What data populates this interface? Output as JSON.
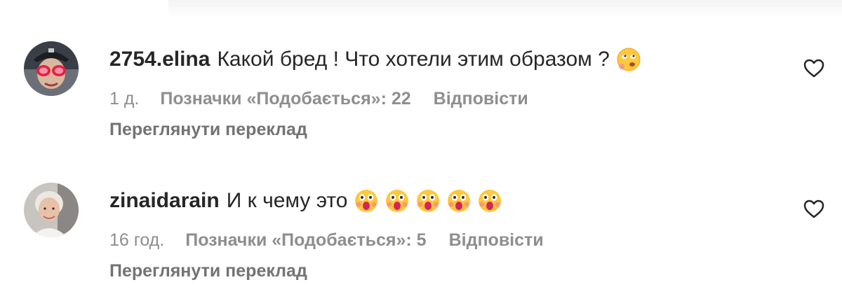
{
  "comments": [
    {
      "username": "2754.elina",
      "text": "Какой бред ! Что хотели этим образом ?",
      "emojis": [
        "face-with-rolling-eyes-emoji"
      ],
      "time": "1 д.",
      "likes": "Позначки «Подобається»: 22",
      "reply": "Відповісти",
      "translate": "Переглянути переклад"
    },
    {
      "username": "zinaidarain",
      "text": "И к чему это",
      "emojis": [
        "astonished-face-emoji",
        "astonished-face-emoji",
        "astonished-face-emoji",
        "astonished-face-emoji",
        "astonished-face-emoji"
      ],
      "time": "16 год.",
      "likes": "Позначки «Подобається»: 5",
      "reply": "Відповісти",
      "translate": "Переглянути переклад"
    }
  ],
  "icons": {
    "like": "heart-outline-icon"
  },
  "colors": {
    "text": "#262626",
    "meta": "#8e8e8e"
  }
}
